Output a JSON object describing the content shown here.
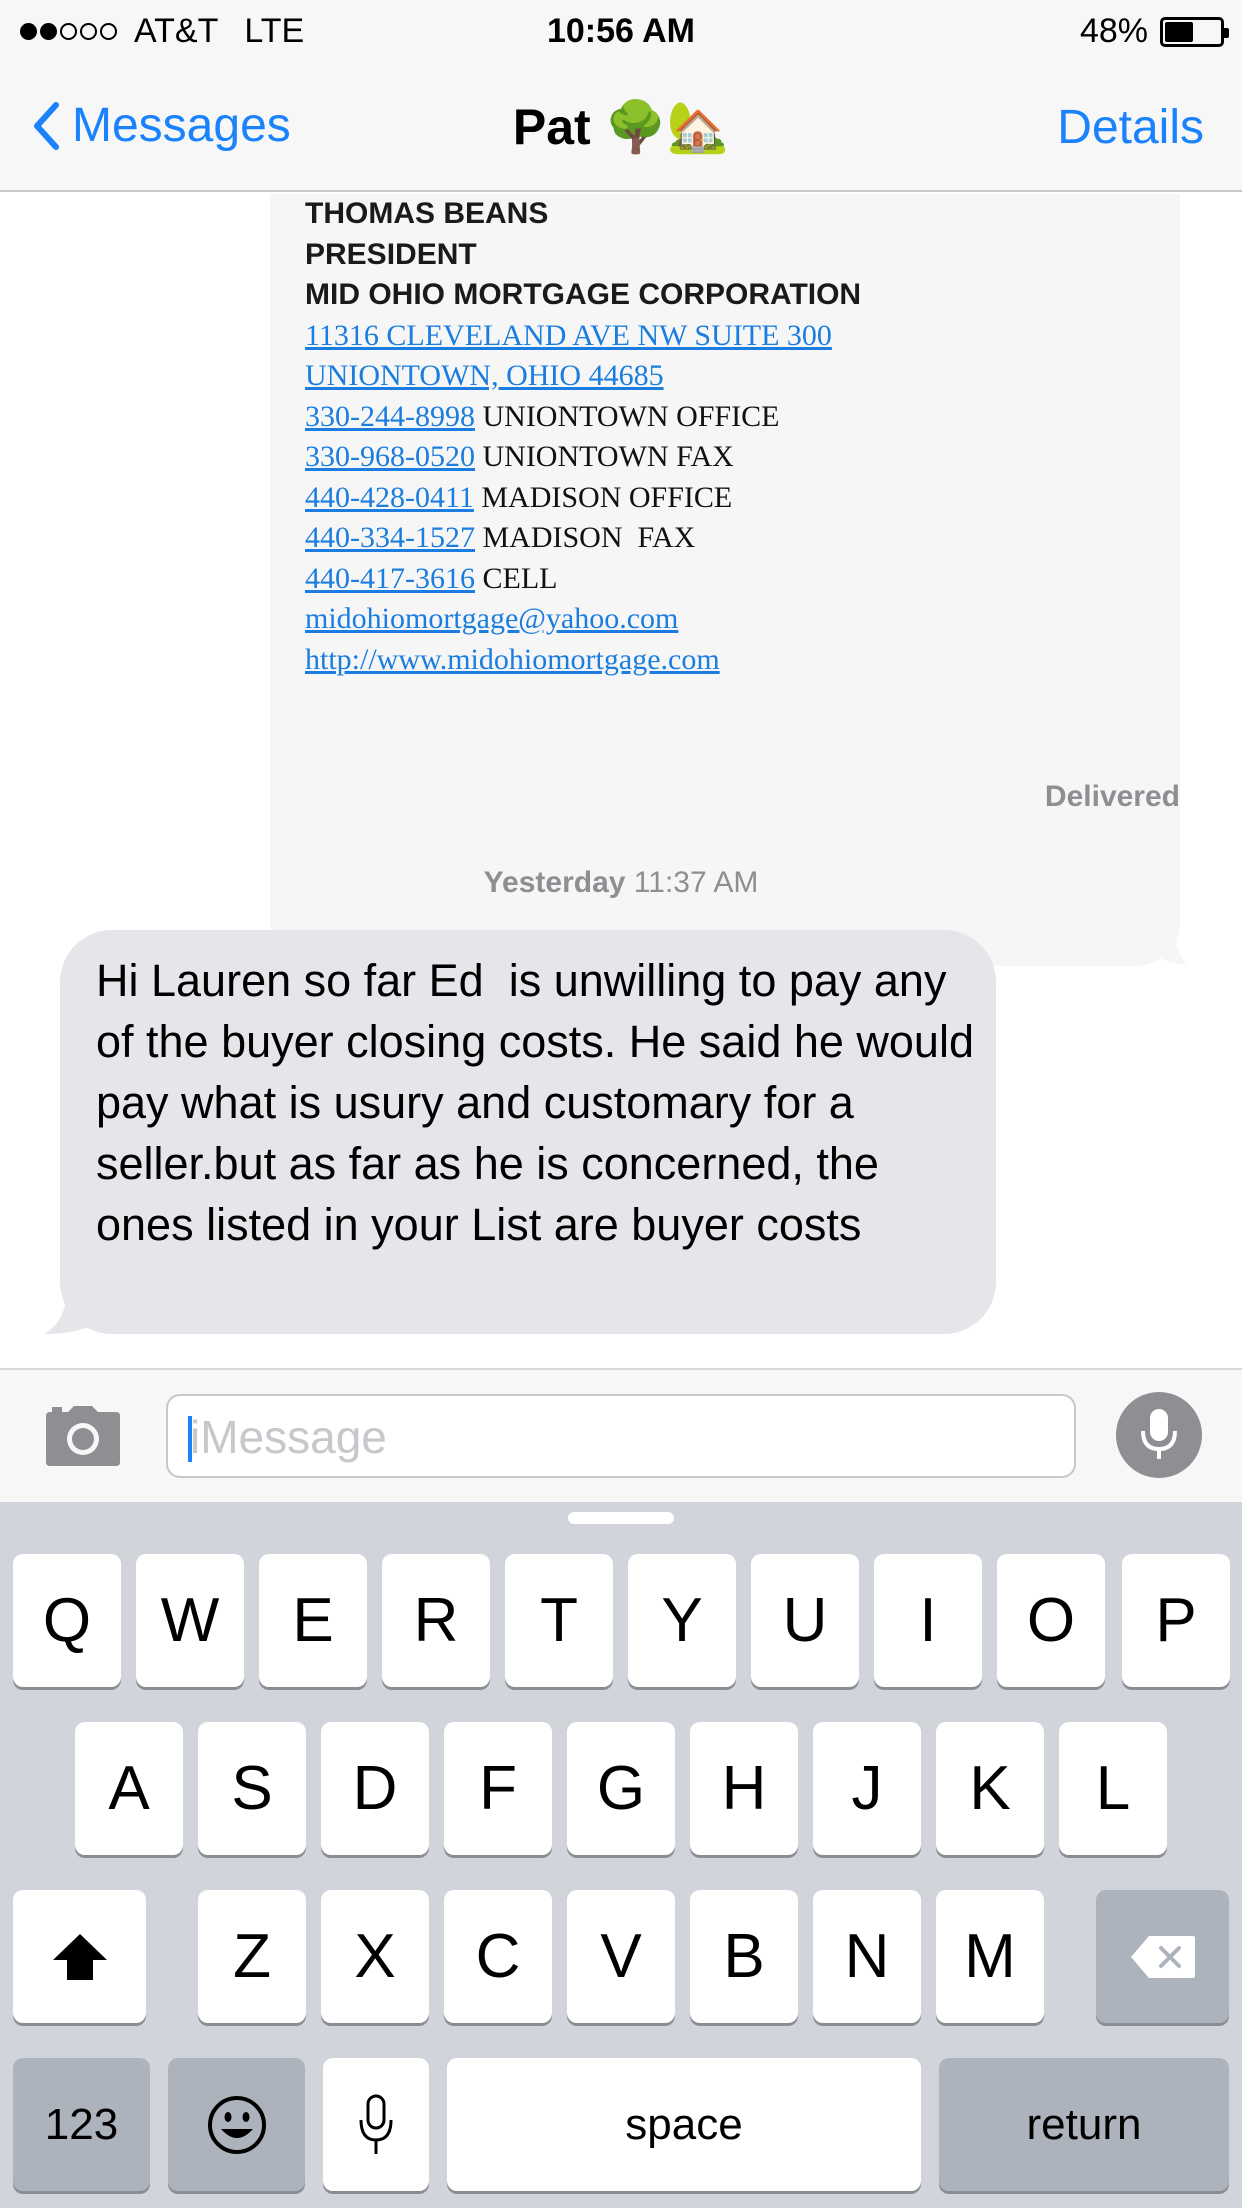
{
  "status_bar": {
    "carrier": "AT&T",
    "network": "LTE",
    "time": "10:56 AM",
    "battery_percent": "48%",
    "battery_level": 0.48,
    "signal_bars_filled": 2,
    "signal_bars_total": 5
  },
  "nav": {
    "back_label": "Messages",
    "title": "Pat 🌳🏡",
    "details_label": "Details"
  },
  "signature": {
    "name": "THOMAS BEANS",
    "role": "PRESIDENT",
    "company": "MID OHIO MORTGAGE CORPORATION",
    "address1": "11316 CLEVELAND AVE NW SUITE 300",
    "address2": "UNIONTOWN, OHIO 44685",
    "phones": [
      {
        "number": "330-244-8998",
        "label": "UNIONTOWN OFFICE"
      },
      {
        "number": "330-968-0520",
        "label": "UNIONTOWN FAX"
      },
      {
        "number": "440-428-0411",
        "label": "MADISON OFFICE"
      },
      {
        "number": "440-334-1527",
        "label": "MADISON  FAX"
      },
      {
        "number": "440-417-3616",
        "label": "CELL"
      }
    ],
    "email": "midohiomortgage@yahoo.com",
    "website": "http://www.midohiomortgage.com"
  },
  "delivered_label": "Delivered",
  "timestamp": {
    "day": "Yesterday",
    "time": "11:37 AM"
  },
  "received_message": "Hi Lauren so far Ed  is unwilling to pay any of the buyer closing costs. He said he would pay what is usury and customary for a seller.but as far as he is concerned, the ones listed in your List are buyer costs",
  "input": {
    "placeholder": "iMessage",
    "value": ""
  },
  "keyboard": {
    "row1": [
      "Q",
      "W",
      "E",
      "R",
      "T",
      "Y",
      "U",
      "I",
      "O",
      "P"
    ],
    "row2": [
      "A",
      "S",
      "D",
      "F",
      "G",
      "H",
      "J",
      "K",
      "L"
    ],
    "row3": [
      "Z",
      "X",
      "C",
      "V",
      "B",
      "N",
      "M"
    ],
    "numbers_label": "123",
    "space_label": "space",
    "return_label": "return"
  }
}
